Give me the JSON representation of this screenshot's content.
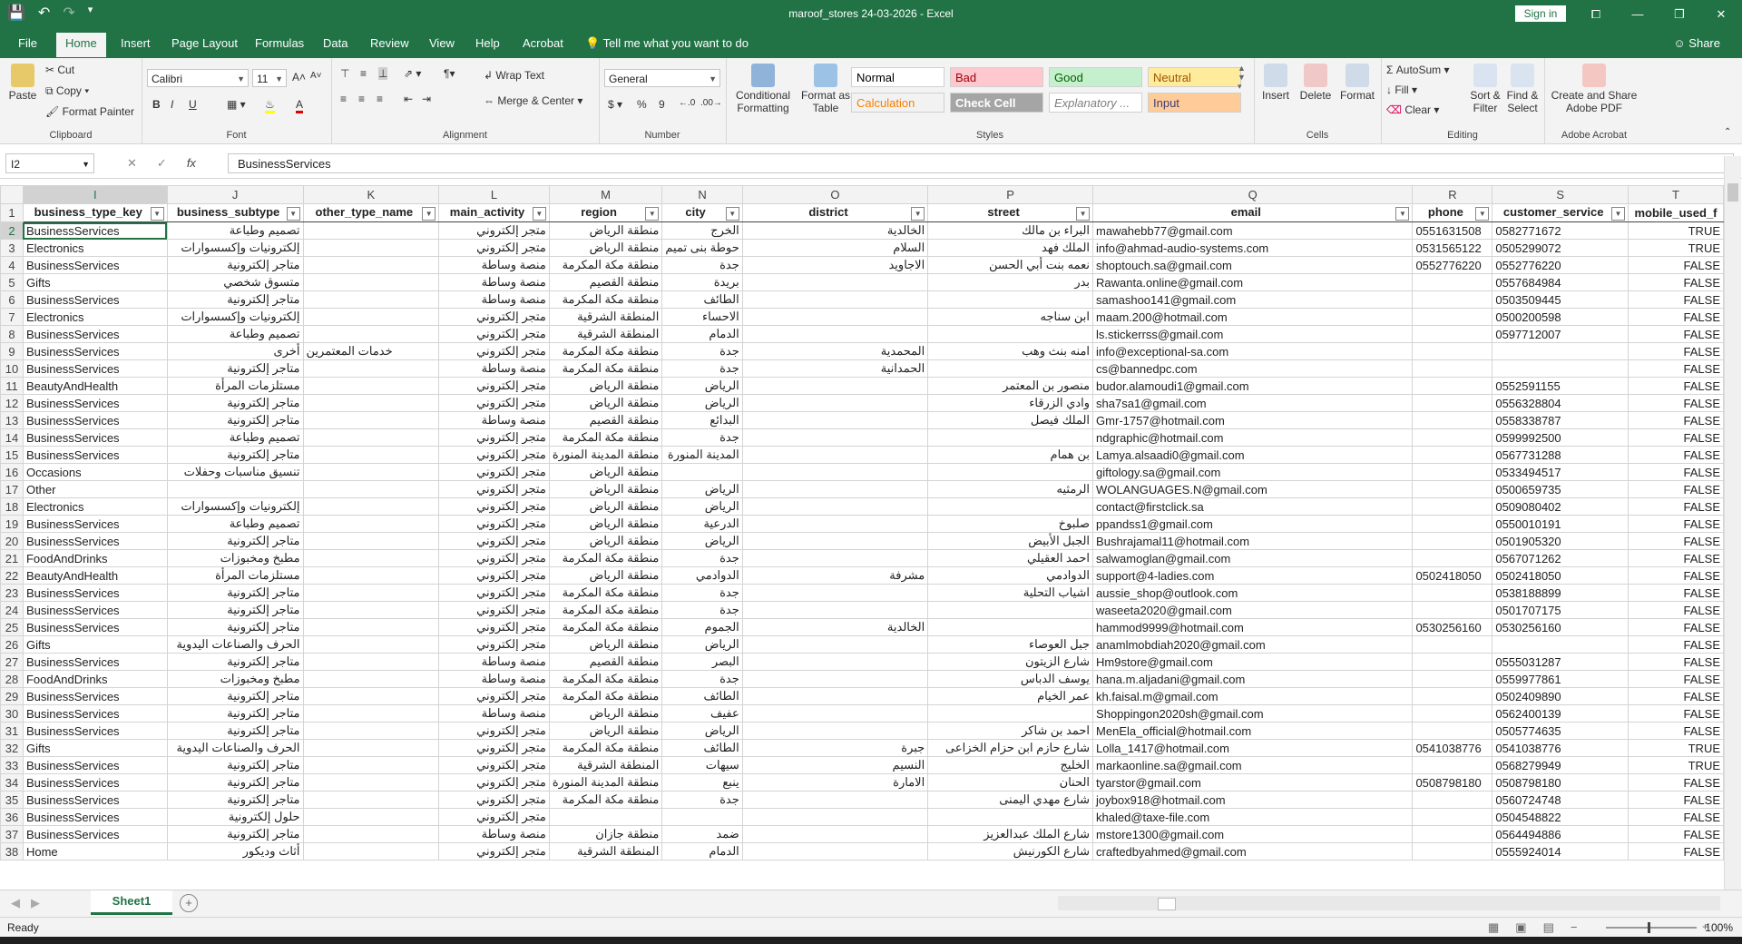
{
  "window": {
    "title": "maroof_stores 24-03-2026  -  Excel",
    "signin": "Sign in",
    "controls": [
      "⧠",
      "—",
      "❐",
      "✕"
    ]
  },
  "tabs": [
    "File",
    "Home",
    "Insert",
    "Page Layout",
    "Formulas",
    "Data",
    "Review",
    "View",
    "Help",
    "Acrobat",
    "Tell me what you want to do"
  ],
  "share_label": "Share",
  "ribbon": {
    "clipboard": {
      "paste": "Paste",
      "cut": "Cut",
      "copy": "Copy",
      "painter": "Format Painter",
      "label": "Clipboard"
    },
    "font": {
      "name": "Calibri",
      "size": "11",
      "label": "Font",
      "bold": "B",
      "italic": "I",
      "underline": "U"
    },
    "alignment": {
      "wrap": "Wrap Text",
      "merge": "Merge & Center",
      "label": "Alignment"
    },
    "number": {
      "format": "General",
      "label": "Number",
      "currency": "$",
      "percent": "%",
      "comma": "9"
    },
    "styles": {
      "conditional": "Conditional Formatting",
      "format_table": "Format as Table",
      "items": [
        {
          "label": "Normal",
          "bg": "#ffffff",
          "fg": "#000000"
        },
        {
          "label": "Bad",
          "bg": "#ffc7ce",
          "fg": "#9c0006"
        },
        {
          "label": "Good",
          "bg": "#c6efce",
          "fg": "#006100"
        },
        {
          "label": "Neutral",
          "bg": "#ffeb9c",
          "fg": "#9c5700"
        },
        {
          "label": "Calculation",
          "bg": "#f2f2f2",
          "fg": "#fa7d00"
        },
        {
          "label": "Check Cell",
          "bg": "#a5a5a5",
          "fg": "#ffffff"
        },
        {
          "label": "Explanatory ...",
          "bg": "#ffffff",
          "fg": "#7f7f7f"
        },
        {
          "label": "Input",
          "bg": "#ffcc99",
          "fg": "#3f3f76"
        }
      ],
      "label": "Styles"
    },
    "cells": {
      "insert": "Insert",
      "delete": "Delete",
      "format": "Format",
      "label": "Cells"
    },
    "editing": {
      "autosum": "AutoSum",
      "fill": "Fill",
      "clear": "Clear",
      "sort": "Sort & Filter",
      "find": "Find & Select",
      "label": "Editing"
    },
    "acrobat": {
      "create": "Create and Share Adobe PDF",
      "label": "Adobe Acrobat"
    }
  },
  "formula_bar": {
    "name_box": "I2",
    "value": "BusinessServices"
  },
  "sheet": {
    "columns": [
      "I",
      "J",
      "K",
      "L",
      "M",
      "N",
      "O",
      "P",
      "Q",
      "R",
      "S",
      "T"
    ],
    "headers": [
      "business_type_key",
      "business_subtype",
      "other_type_name",
      "main_activity",
      "region",
      "city",
      "district",
      "street",
      "email",
      "phone",
      "customer_service",
      "mobile_used_f"
    ],
    "rows": [
      [
        "BusinessServices",
        "تصميم وطباعة",
        "",
        "متجر إلكتروني",
        "منطقة الرياض",
        "الخرج",
        "الخالدية",
        "البراء بن مالك",
        "mawahebb77@gmail.com",
        "0551631508",
        "0582771672",
        "TRUE"
      ],
      [
        "Electronics",
        "إلكترونيات وإكسسوارات",
        "",
        "متجر إلكتروني",
        "منطقة الرياض",
        "حوطة بنى تميم",
        "السلام",
        "الملك فهد",
        "info@ahmad-audio-systems.com",
        "0531565122",
        "0505299072",
        "TRUE"
      ],
      [
        "BusinessServices",
        "متاجر إلكترونية",
        "",
        "منصة وساطة",
        "منطقة مكة المكرمة",
        "جدة",
        "الاجاويد",
        "نعمه بنت أبي الحسن",
        "shoptouch.sa@gmail.com",
        "0552776220",
        "0552776220",
        "FALSE"
      ],
      [
        "Gifts",
        "متسوق شخصي",
        "",
        "منصة وساطة",
        "منطقة القصيم",
        "بريدة",
        "",
        "بدر",
        "Rawanta.online@gmail.com",
        "",
        "0557684984",
        "FALSE"
      ],
      [
        "BusinessServices",
        "متاجر إلكترونية",
        "",
        "منصة وساطة",
        "منطقة مكة المكرمة",
        "الطائف",
        "",
        "",
        "samashoo141@gmail.com",
        "",
        "0503509445",
        "FALSE"
      ],
      [
        "Electronics",
        "إلكترونيات وإكسسوارات",
        "",
        "متجر إلكتروني",
        "المنطقة الشرقية",
        "الاحساء",
        "",
        "ابن سناجه",
        "maam.200@hotmail.com",
        "",
        "0500200598",
        "FALSE"
      ],
      [
        "BusinessServices",
        "تصميم وطباعة",
        "",
        "متجر إلكتروني",
        "المنطقة الشرقية",
        "الدمام",
        "",
        "",
        "ls.stickerrss@gmail.com",
        "",
        "0597712007",
        "FALSE"
      ],
      [
        "BusinessServices",
        "أخرى",
        "خدمات المعتمرين",
        "متجر إلكتروني",
        "منطقة مكة المكرمة",
        "جدة",
        "المحمدية",
        "امنه بنث وهب",
        "info@exceptional-sa.com",
        "",
        "",
        "FALSE"
      ],
      [
        "BusinessServices",
        "متاجر إلكترونية",
        "",
        "منصة وساطة",
        "منطقة مكة المكرمة",
        "جدة",
        "الحمدانية",
        "",
        "cs@bannedpc.com",
        "",
        "",
        "FALSE"
      ],
      [
        "BeautyAndHealth",
        "مستلزمات المرأة",
        "",
        "متجر إلكتروني",
        "منطقة الرياض",
        "الرياض",
        "",
        "منصور بن المعتمر",
        "budor.alamoudi1@gmail.com",
        "",
        "0552591155",
        "FALSE"
      ],
      [
        "BusinessServices",
        "متاجر إلكترونية",
        "",
        "متجر إلكتروني",
        "منطقة الرياض",
        "الرياض",
        "",
        "وادي الزرقاء",
        "sha7sa1@gmail.com",
        "",
        "0556328804",
        "FALSE"
      ],
      [
        "BusinessServices",
        "متاجر إلكترونية",
        "",
        "منصة وساطة",
        "منطقة القصيم",
        "البدائع",
        "",
        "الملك فيصل",
        "Gmr-1757@hotmail.com",
        "",
        "0558338787",
        "FALSE"
      ],
      [
        "BusinessServices",
        "تصميم وطباعة",
        "",
        "متجر إلكتروني",
        "منطقة مكة المكرمة",
        "جدة",
        "",
        "",
        "ndgraphic@hotmail.com",
        "",
        "0599992500",
        "FALSE"
      ],
      [
        "BusinessServices",
        "متاجر إلكترونية",
        "",
        "متجر إلكتروني",
        "منطقة المدينة المنورة",
        "المدينة المنورة",
        "",
        "بن همام",
        "Lamya.alsaadi0@gmail.com",
        "",
        "0567731288",
        "FALSE"
      ],
      [
        "Occasions",
        "تنسيق مناسبات وحفلات",
        "",
        "متجر إلكتروني",
        "منطقة الرياض",
        "",
        "",
        "",
        "giftology.sa@gmail.com",
        "",
        "0533494517",
        "FALSE"
      ],
      [
        "Other",
        "",
        "",
        "متجر إلكتروني",
        "منطقة الرياض",
        "الرياض",
        "",
        "الرمثيه",
        "WOLANGUAGES.N@gmail.com",
        "",
        "0500659735",
        "FALSE"
      ],
      [
        "Electronics",
        "إلكترونيات وإكسسوارات",
        "",
        "متجر إلكتروني",
        "منطقة الرياض",
        "الرياض",
        "",
        "",
        "contact@firstclick.sa",
        "",
        "0509080402",
        "FALSE"
      ],
      [
        "BusinessServices",
        "تصميم وطباعة",
        "",
        "متجر إلكتروني",
        "منطقة الرياض",
        "الدرعية",
        "",
        "صلبوخ",
        "ppandss1@gmail.com",
        "",
        "0550010191",
        "FALSE"
      ],
      [
        "BusinessServices",
        "متاجر إلكترونية",
        "",
        "متجر إلكتروني",
        "منطقة الرياض",
        "الرياض",
        "",
        "الجبل الأبيض",
        "Bushrajamal11@hotmail.com",
        "",
        "0501905320",
        "FALSE"
      ],
      [
        "FoodAndDrinks",
        "مطبخ ومخبوزات",
        "",
        "متجر إلكتروني",
        "منطقة مكة المكرمة",
        "جدة",
        "",
        "احمد العقيلي",
        "salwamoglan@gmail.com",
        "",
        "0567071262",
        "FALSE"
      ],
      [
        "BeautyAndHealth",
        "مستلزمات المرأة",
        "",
        "متجر إلكتروني",
        "منطقة الرياض",
        "الدوادمي",
        "مشرفة",
        "الدوادمي",
        "support@4-ladies.com",
        "0502418050",
        "0502418050",
        "FALSE"
      ],
      [
        "BusinessServices",
        "متاجر إلكترونية",
        "",
        "متجر إلكتروني",
        "منطقة مكة المكرمة",
        "جدة",
        "",
        "اشياب التحلية",
        "aussie_shop@outlook.com",
        "",
        "0538188899",
        "FALSE"
      ],
      [
        "BusinessServices",
        "متاجر إلكترونية",
        "",
        "متجر إلكتروني",
        "منطقة مكة المكرمة",
        "جدة",
        "",
        "",
        "waseeta2020@gmail.com",
        "",
        "0501707175",
        "FALSE"
      ],
      [
        "BusinessServices",
        "متاجر إلكترونية",
        "",
        "متجر إلكتروني",
        "منطقة مكة المكرمة",
        "الجموم",
        "الخالدية",
        "",
        "hammod9999@hotmail.com",
        "0530256160",
        "0530256160",
        "FALSE"
      ],
      [
        "Gifts",
        "الحرف والصناعات اليدوية",
        "",
        "متجر إلكتروني",
        "منطقة الرياض",
        "الرياض",
        "",
        "جبل العوصاء",
        "anamlmobdiah2020@gmail.com",
        "",
        "",
        "FALSE"
      ],
      [
        "BusinessServices",
        "متاجر إلكترونية",
        "",
        "منصة وساطة",
        "منطقة القصيم",
        "البصر",
        "",
        "شارع الزيتون",
        "Hm9store@gmail.com",
        "",
        "0555031287",
        "FALSE"
      ],
      [
        "FoodAndDrinks",
        "مطبخ ومخبوزات",
        "",
        "منصة وساطة",
        "منطقة مكة المكرمة",
        "جدة",
        "",
        "يوسف الدباس",
        "hana.m.aljadani@gmail.com",
        "",
        "0559977861",
        "FALSE"
      ],
      [
        "BusinessServices",
        "متاجر إلكترونية",
        "",
        "متجر إلكتروني",
        "منطقة مكة المكرمة",
        "الطائف",
        "",
        "عمر الخيام",
        "kh.faisal.m@gmail.com",
        "",
        "0502409890",
        "FALSE"
      ],
      [
        "BusinessServices",
        "متاجر إلكترونية",
        "",
        "منصة وساطة",
        "منطقة الرياض",
        "عفيف",
        "",
        "",
        "Shoppingon2020sh@gmail.com",
        "",
        "0562400139",
        "FALSE"
      ],
      [
        "BusinessServices",
        "متاجر إلكترونية",
        "",
        "متجر إلكتروني",
        "منطقة الرياض",
        "الرياض",
        "",
        "احمد بن شاكر",
        "MenEla_official@hotmail.com",
        "",
        "0505774635",
        "FALSE"
      ],
      [
        "Gifts",
        "الحرف والصناعات اليدوية",
        "",
        "متجر إلكتروني",
        "منطقة مكة المكرمة",
        "الطائف",
        "جبرة",
        "شارع حازم ابن حزام الخزاعى",
        "Lolla_1417@hotmail.com",
        "0541038776",
        "0541038776",
        "TRUE"
      ],
      [
        "BusinessServices",
        "متاجر إلكترونية",
        "",
        "متجر إلكتروني",
        "المنطقة الشرقية",
        "سيهات",
        "النسيم",
        "الخليج",
        "markaonline.sa@gmail.com",
        "",
        "0568279949",
        "TRUE"
      ],
      [
        "BusinessServices",
        "متاجر إلكترونية",
        "",
        "متجر إلكتروني",
        "منطقة المدينة المنورة",
        "ينبع",
        "الامارة",
        "الحنان",
        "tyarstor@gmail.com",
        "0508798180",
        "0508798180",
        "FALSE"
      ],
      [
        "BusinessServices",
        "متاجر إلكترونية",
        "",
        "متجر إلكتروني",
        "منطقة مكة المكرمة",
        "جدة",
        "",
        "شارع مهدي اليمنى",
        "joybox918@hotmail.com",
        "",
        "0560724748",
        "FALSE"
      ],
      [
        "BusinessServices",
        "حلول إلكترونية",
        "",
        "متجر إلكتروني",
        "",
        "",
        "",
        "",
        "khaled@taxe-file.com",
        "",
        "0504548822",
        "FALSE"
      ],
      [
        "BusinessServices",
        "متاجر إلكترونية",
        "",
        "منصة وساطة",
        "منطقة جازان",
        "ضمد",
        "",
        "شارع الملك عبدالعزيز",
        "mstore1300@gmail.com",
        "",
        "0564494886",
        "FALSE"
      ],
      [
        "Home",
        "أثاث وديكور",
        "",
        "متجر إلكتروني",
        "المنطقة الشرقية",
        "الدمام",
        "",
        "شارع الكورنيش",
        "craftedbyahmed@gmail.com",
        "",
        "0555924014",
        "FALSE"
      ]
    ]
  },
  "sheet_tab": "Sheet1",
  "status": {
    "ready": "Ready",
    "zoom": "100%"
  }
}
